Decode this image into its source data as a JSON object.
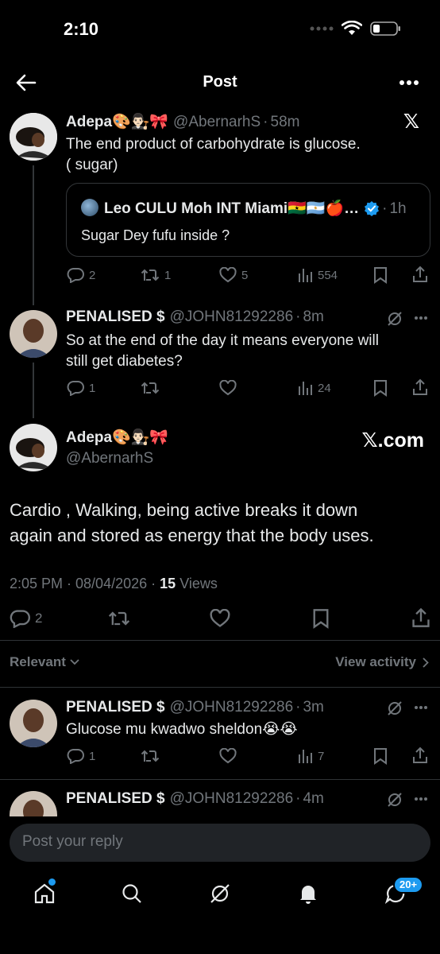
{
  "status_bar": {
    "time": "2:10"
  },
  "header": {
    "title": "Post"
  },
  "tweet1": {
    "name": "Adepa🎨👨🏻‍⚖️🎀",
    "handle": "@AbernarhS",
    "sep": "·",
    "time": "58m",
    "text1": "The end product of carbohydrate  is glucose.",
    "text2": "( sugar)",
    "quote": {
      "name": "Leo CULU Moh INT Miami🇬🇭🇦🇷🍎…",
      "sep": "·",
      "time": "1h",
      "text": "Sugar Dey fufu inside ?"
    },
    "replies": "2",
    "reposts": "1",
    "likes": "5",
    "views": "554"
  },
  "tweet2": {
    "name": "PENALISED $",
    "handle": "@JOHN81292286",
    "sep": "·",
    "time": "8m",
    "text1": "So at the end of the day it means everyone will",
    "text2": "still get diabetes?",
    "replies": "1",
    "views": "24"
  },
  "main_tweet": {
    "name": "Adepa🎨👨🏻‍⚖️🎀",
    "handle": "@AbernarhS",
    "watermark": "𝕏.com",
    "text1": "Cardio , Walking, being active breaks it down",
    "text2": "again and stored as energy that the body uses.",
    "timestamp": "2:05 PM · 08/04/2026 ·",
    "views_count": "15",
    "views_label": "Views",
    "replies": "2"
  },
  "sort": {
    "label": "Relevant",
    "view_activity": "View activity"
  },
  "reply1": {
    "name": "PENALISED $",
    "handle": "@JOHN81292286",
    "sep": "·",
    "time": "3m",
    "text": "Glucose mu kwadwo sheldon😭😭",
    "replies": "1",
    "views": "7"
  },
  "reply2": {
    "name": "PENALISED $",
    "handle": "@JOHN81292286",
    "sep": "·",
    "time": "4m"
  },
  "reply_box": {
    "placeholder": "Post your reply"
  },
  "tabbar": {
    "messages_badge": "20+"
  },
  "colors": {
    "accent": "#1d9bf0",
    "background": "#000000",
    "muted": "#71767b"
  }
}
